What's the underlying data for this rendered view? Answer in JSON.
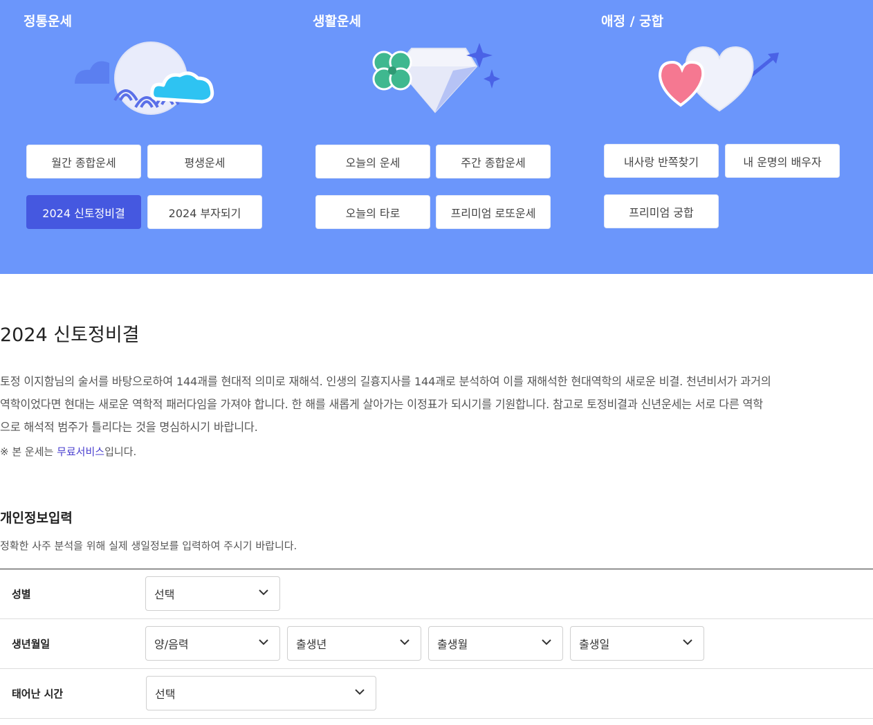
{
  "categories": [
    {
      "title": "정통운세",
      "buttons": [
        "월간 종합운세",
        "평생운세",
        "2024 신토정비결",
        "2024 부자되기"
      ],
      "active_index": 2
    },
    {
      "title": "생활운세",
      "buttons": [
        "오늘의 운세",
        "주간 종합운세",
        "오늘의 타로",
        "프리미엄 로또운세"
      ]
    },
    {
      "title": "애정 / 궁합",
      "buttons": [
        "내사랑 반쪽찾기",
        "내 운명의 배우자",
        "프리미엄 궁합"
      ]
    }
  ],
  "page": {
    "title": "2024 신토정비결",
    "description_lines": [
      "토정 이지함님의 술서를 바탕으로하여 144괘를 현대적 의미로 재해석. 인생의 길흉지사를 144괘로 분석하여 이를 재해석한 현대역학의 새로운 비결. 천년비서가 과거의",
      "역학이었다면 현대는 새로운 역학적 패러다임을 가져야 합니다. 한 해를 새롭게 살아가는 이정표가 되시기를 기원합니다. 참고로 토정비결과 신년운세는 서로 다른 역학",
      "으로 해석적 범주가 틀리다는 것을 명심하시기 바랍니다."
    ],
    "note_prefix": "※ 본 운세는 ",
    "note_link": "무료서비스",
    "note_suffix": "입니다."
  },
  "form": {
    "title": "개인정보입력",
    "subtitle": "정확한 사주 분석을 위해 실제 생일정보를 입력하여 주시기 바랍니다.",
    "rows": [
      {
        "label": "성별",
        "selects": [
          "선택"
        ]
      },
      {
        "label": "생년월일",
        "selects": [
          "양/음력",
          "출생년",
          "출생월",
          "출생일"
        ]
      },
      {
        "label": "태어난 시간",
        "selects": [
          "선택"
        ]
      }
    ]
  },
  "colors": {
    "banner": "#6b96fb",
    "active_button": "#4558e0",
    "link": "#4a3fcf"
  },
  "icons": [
    "moon-wave-cloud-icon",
    "clover-diamond-icon",
    "hearts-arrow-icon",
    "chevron-down-icon"
  ]
}
